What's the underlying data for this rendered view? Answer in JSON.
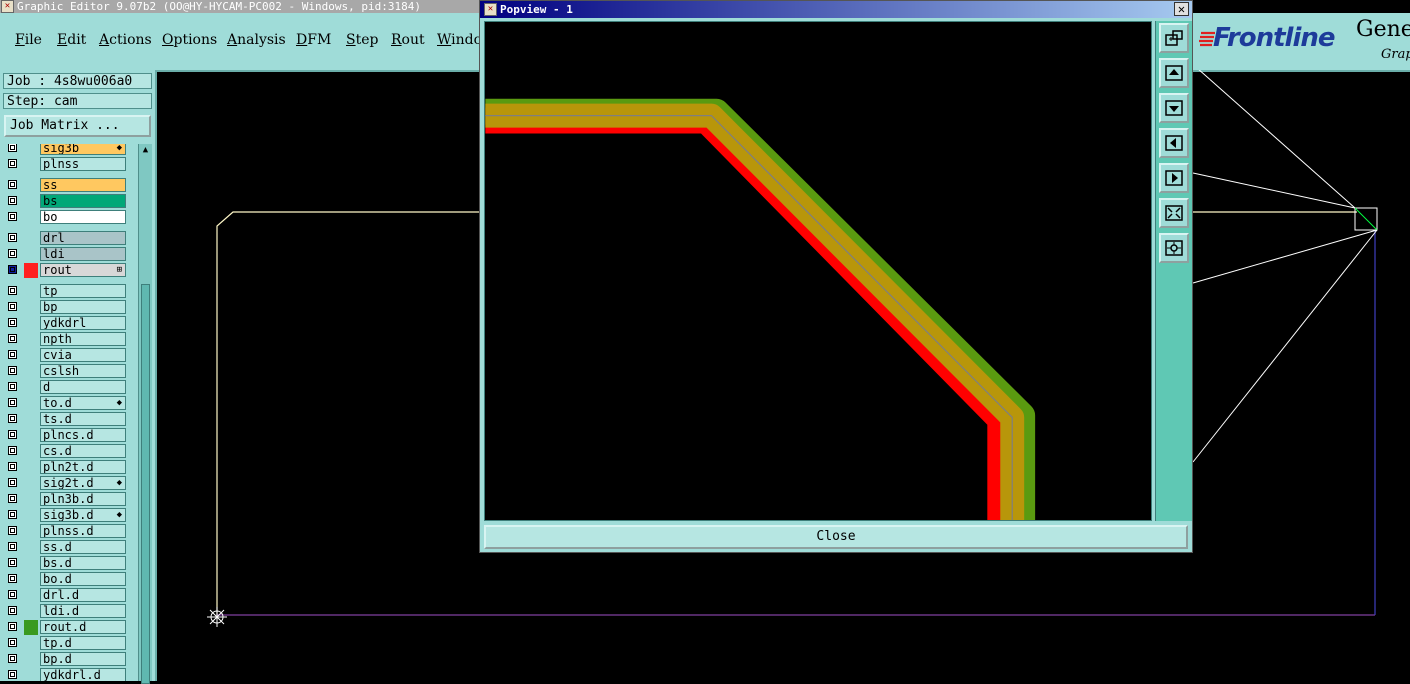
{
  "window": {
    "title": "Graphic Editor 9.07b2 (OO@HY-HYCAM-PC002 - Windows, pid:3184)"
  },
  "menu": {
    "items": [
      "File",
      "Edit",
      "Actions",
      "Options",
      "Analysis",
      "DFM",
      "Step",
      "Rout",
      "Windo"
    ]
  },
  "branding": {
    "logo": "Frontline",
    "product_partial": "Gene",
    "product_sub_partial": "Grap",
    "logo_color": "#1d3b9a",
    "logo_mark_color": "#e02020"
  },
  "job_panel": {
    "job_line": "Job : 4s8wu006a0",
    "step_line": "Step: cam",
    "job_matrix_button": "Job Matrix ..."
  },
  "layers": [
    {
      "name": "sig3b",
      "color": "#ffc860",
      "mark": "◆",
      "clipped": true
    },
    {
      "name": "plnss",
      "color": "#b6e6e2"
    },
    {
      "name": "ss",
      "color": "#ffc860"
    },
    {
      "name": "bs",
      "color": "#00a878"
    },
    {
      "name": "bo",
      "color": "#ffffff"
    },
    {
      "name": "drl",
      "color": "#a9c4c8"
    },
    {
      "name": "ldi",
      "color": "#a9c4c8"
    },
    {
      "name": "rout",
      "color": "#d8d8d8",
      "mark": "⊞",
      "active": true
    },
    {
      "name": "tp",
      "color": "#b6e6e2"
    },
    {
      "name": "bp",
      "color": "#b6e6e2"
    },
    {
      "name": "ydkdrl",
      "color": "#b6e6e2"
    },
    {
      "name": "npth",
      "color": "#b6e6e2"
    },
    {
      "name": "cvia",
      "color": "#b6e6e2"
    },
    {
      "name": "cslsh",
      "color": "#b6e6e2"
    },
    {
      "name": "d",
      "color": "#b6e6e2"
    },
    {
      "name": "to.d",
      "color": "#b6e6e2",
      "mark": "◆"
    },
    {
      "name": "ts.d",
      "color": "#b6e6e2"
    },
    {
      "name": "plncs.d",
      "color": "#b6e6e2"
    },
    {
      "name": "cs.d",
      "color": "#b6e6e2"
    },
    {
      "name": "pln2t.d",
      "color": "#b6e6e2"
    },
    {
      "name": "sig2t.d",
      "color": "#b6e6e2",
      "mark": "◆"
    },
    {
      "name": "pln3b.d",
      "color": "#b6e6e2"
    },
    {
      "name": "sig3b.d",
      "color": "#b6e6e2",
      "mark": "◆"
    },
    {
      "name": "plnss.d",
      "color": "#b6e6e2"
    },
    {
      "name": "ss.d",
      "color": "#b6e6e2"
    },
    {
      "name": "bs.d",
      "color": "#b6e6e2"
    },
    {
      "name": "bo.d",
      "color": "#b6e6e2"
    },
    {
      "name": "drl.d",
      "color": "#b6e6e2"
    },
    {
      "name": "ldi.d",
      "color": "#b6e6e2"
    },
    {
      "name": "rout.d",
      "color": "#b6e6e2",
      "green_selector": true
    },
    {
      "name": "tp.d",
      "color": "#b6e6e2"
    },
    {
      "name": "bp.d",
      "color": "#b6e6e2"
    },
    {
      "name": "ydkdrl.d",
      "color": "#b6e6e2"
    }
  ],
  "popview": {
    "title": "Popview - 1",
    "close_button": "Close",
    "tools": [
      "zoom-window-icon",
      "zoom-up-icon",
      "zoom-down-icon",
      "pan-left-icon",
      "pan-right-icon",
      "zoom-fit-icon",
      "zoom-center-icon"
    ],
    "trace_colors": {
      "fill": "#b8960a",
      "edge_red": "#ff0000",
      "edge_green": "#5a9a10",
      "center": "#7f7f7f"
    }
  },
  "colors": {
    "panel": "#9fdcd8",
    "canvas": "#000000"
  }
}
